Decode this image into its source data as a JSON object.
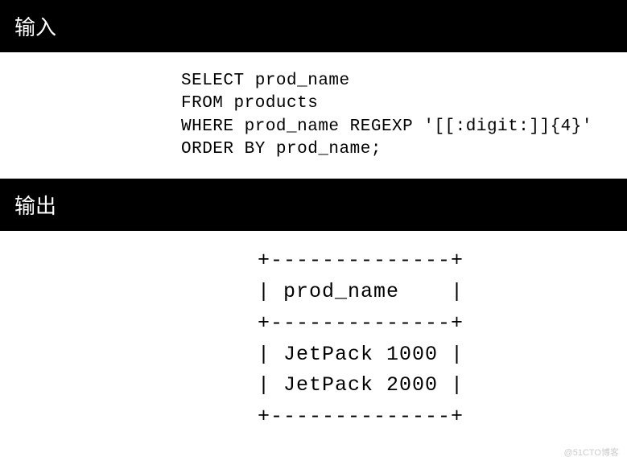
{
  "input": {
    "label": "输入",
    "lines": [
      "SELECT prod_name",
      "FROM products",
      "WHERE prod_name REGEXP '[[:digit:]]{4}'",
      "ORDER BY prod_name;"
    ]
  },
  "output": {
    "label": "输出",
    "lines": [
      "+--------------+",
      "| prod_name    |",
      "+--------------+",
      "| JetPack 1000 |",
      "| JetPack 2000 |",
      "+--------------+"
    ]
  },
  "watermark": "@51CTO博客"
}
